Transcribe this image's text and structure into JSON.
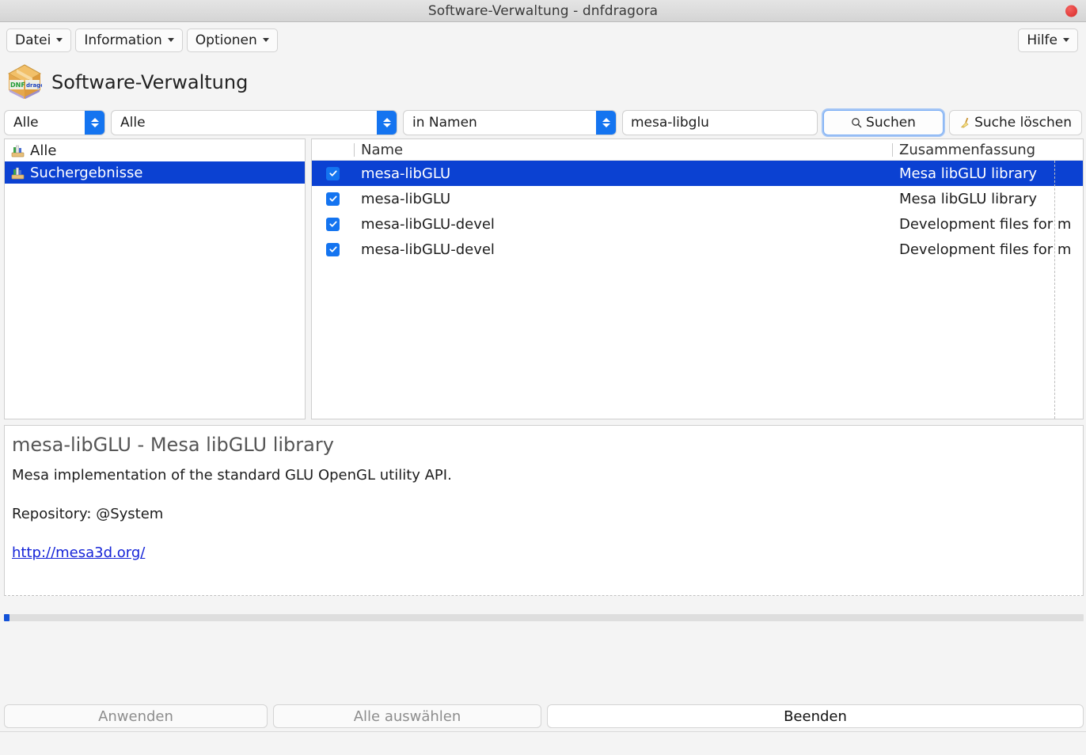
{
  "window": {
    "title": "Software-Verwaltung - dnfdragora",
    "close_icon": "close-dot-icon"
  },
  "menubar": {
    "items": [
      {
        "label": "Datei",
        "icon": "chevron-down-icon"
      },
      {
        "label": "Information",
        "icon": "chevron-down-icon"
      },
      {
        "label": "Optionen",
        "icon": "chevron-down-icon"
      }
    ],
    "help": {
      "label": "Hilfe",
      "icon": "chevron-down-icon"
    }
  },
  "appheader": {
    "icon": "dnfdragora-box-icon",
    "title": "Software-Verwaltung"
  },
  "searchbar": {
    "filter_group": {
      "value": "Alle",
      "icon": "spinner-arrows-icon"
    },
    "filter_category": {
      "value": "Alle",
      "icon": "spinner-arrows-icon"
    },
    "filter_field": {
      "value": "in Namen",
      "icon": "spinner-arrows-icon"
    },
    "query": {
      "value": "mesa-libglu",
      "placeholder": ""
    },
    "search_button": {
      "label": "Suchen",
      "icon": "search-icon"
    },
    "clear_button": {
      "label": "Suche löschen",
      "icon": "broom-icon"
    }
  },
  "tree": {
    "items": [
      {
        "label": "Alle",
        "icon": "group-shelf-icon",
        "selected": false
      },
      {
        "label": "Suchergebnisse",
        "icon": "group-shelf-icon",
        "selected": true
      }
    ]
  },
  "package_list": {
    "columns": {
      "check": "",
      "name": "Name",
      "summary": "Zusammenfassung"
    },
    "rows": [
      {
        "checked": true,
        "name": "mesa-libGLU",
        "summary": "Mesa libGLU library",
        "selected": true
      },
      {
        "checked": true,
        "name": "mesa-libGLU",
        "summary": "Mesa libGLU library",
        "selected": false
      },
      {
        "checked": true,
        "name": "mesa-libGLU-devel",
        "summary": "Development files for m",
        "selected": false
      },
      {
        "checked": true,
        "name": "mesa-libGLU-devel",
        "summary": "Development files for m",
        "selected": false
      }
    ]
  },
  "detail": {
    "title": "mesa-libGLU - Mesa libGLU library",
    "description": "Mesa implementation of the standard GLU OpenGL utility API.",
    "repository": "Repository: @System",
    "url": "http://mesa3d.org/"
  },
  "progress": {
    "percent": 0
  },
  "footer": {
    "apply": {
      "label": "Anwenden",
      "enabled": false
    },
    "select_all": {
      "label": "Alle auswählen",
      "enabled": false
    },
    "quit": {
      "label": "Beenden",
      "enabled": true
    }
  },
  "colors": {
    "selection_blue": "#0b41d2",
    "accent_blue": "#1474f0",
    "link_blue": "#1524d8",
    "close_red": "#e03a38"
  }
}
